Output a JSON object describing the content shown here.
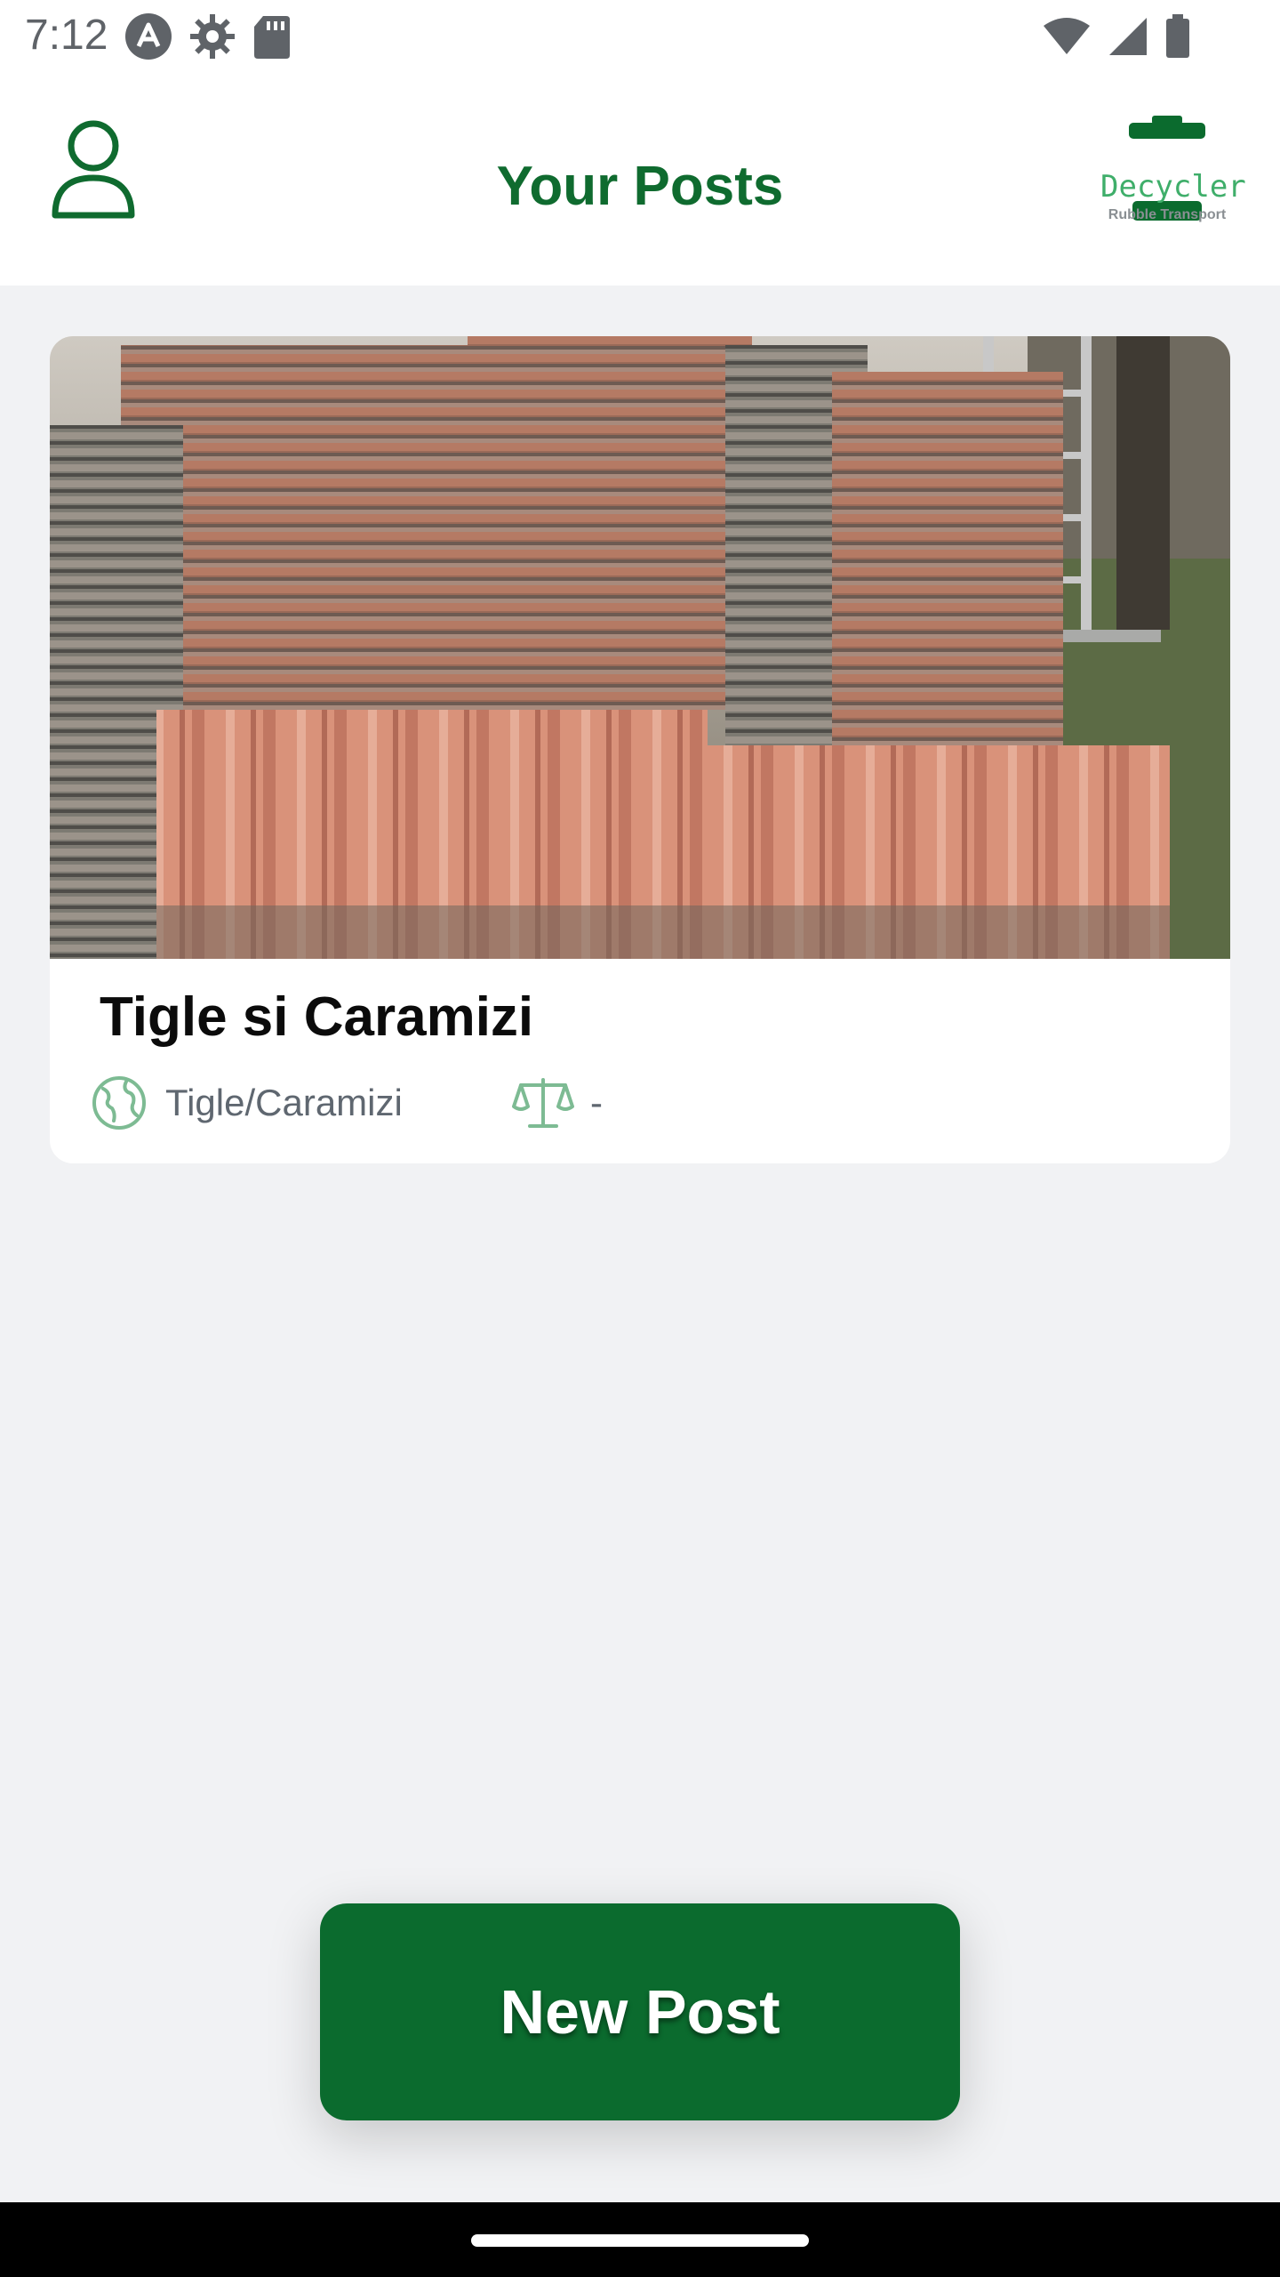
{
  "status_bar": {
    "time": "7:12",
    "left_icons": [
      "android-auto-icon",
      "settings-gear-icon",
      "sd-card-icon"
    ],
    "right_icons": [
      "wifi-icon",
      "cell-signal-icon",
      "battery-icon"
    ]
  },
  "header": {
    "title": "Your Posts",
    "logo_text": "Decycler",
    "logo_subtext": "Rubble Transport",
    "profile_icon": "person-outline-icon"
  },
  "posts": [
    {
      "title": "Tigle si Caramizi",
      "category": "Tigle/Caramizi",
      "weight": "-",
      "category_icon": "globe-icon",
      "weight_icon": "scale-icon"
    }
  ],
  "new_post_button": {
    "label": "New Post"
  },
  "colors": {
    "primary_green": "#0b6b2e",
    "title_green": "#0f6b2f",
    "accent_green": "#3fae6a",
    "background": "#f1f2f4"
  }
}
